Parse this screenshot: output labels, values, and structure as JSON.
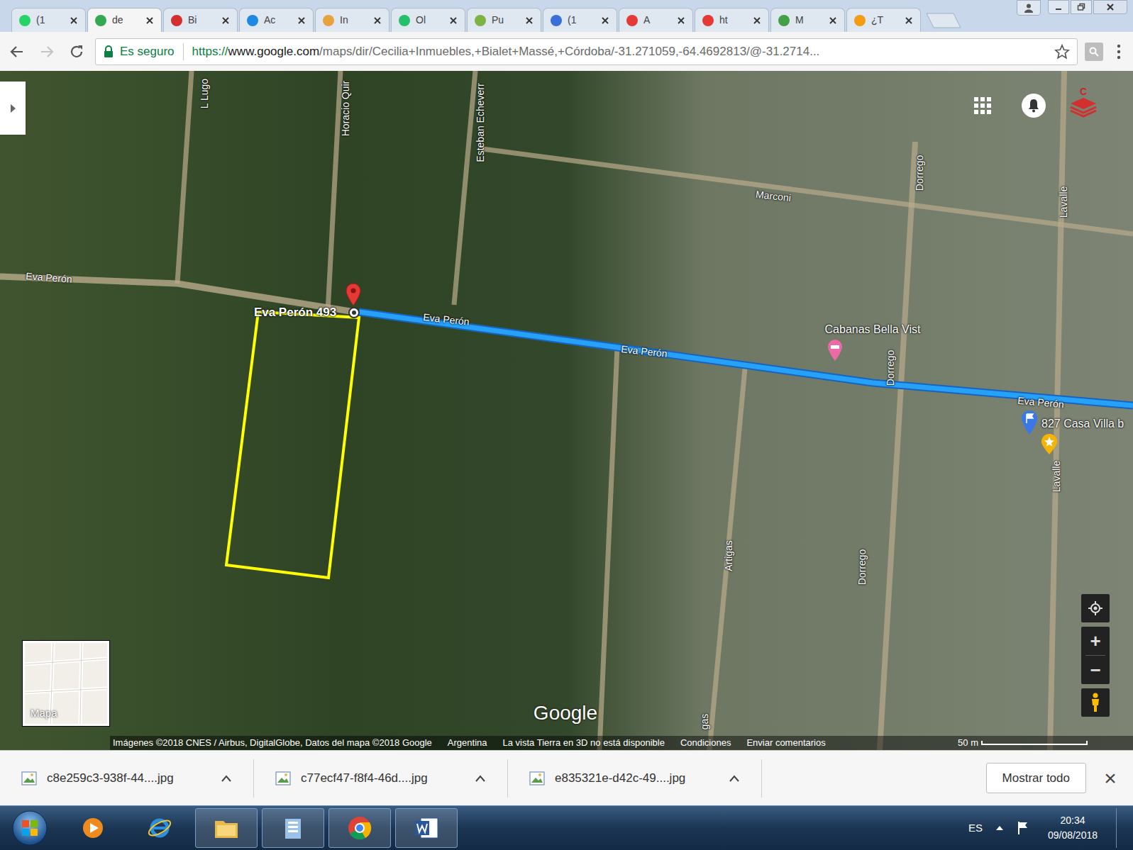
{
  "tabs": [
    {
      "label": "(1",
      "selected": false,
      "color": "#25d366"
    },
    {
      "label": "de",
      "selected": true,
      "color": "#34a853"
    },
    {
      "label": "Bi",
      "selected": false,
      "color": "#d32f2f"
    },
    {
      "label": "Ac",
      "selected": false,
      "color": "#1e88e5"
    },
    {
      "label": "In",
      "selected": false,
      "color": "#e6a23c"
    },
    {
      "label": "Ol",
      "selected": false,
      "color": "#23c16b"
    },
    {
      "label": "Pu",
      "selected": false,
      "color": "#7cb342"
    },
    {
      "label": "(1",
      "selected": false,
      "color": "#3b6fd8"
    },
    {
      "label": "A",
      "selected": false,
      "color": "#e53935"
    },
    {
      "label": "ht",
      "selected": false,
      "color": "#e53935"
    },
    {
      "label": "M",
      "selected": false,
      "color": "#43a047"
    },
    {
      "label": "¿T",
      "selected": false,
      "color": "#f39c12"
    }
  ],
  "toolbar": {
    "security": "Es seguro",
    "url_scheme": "https://",
    "url_host": "www.google.com",
    "url_path": "/maps/dir/Cecilia+Inmuebles,+Bialet+Massé,+Córdoba/-31.271059,-64.4692813/@-31.2714..."
  },
  "map": {
    "labels": [
      {
        "text": "L Lugo",
        "kind": "street"
      },
      {
        "text": "Horacio Quir",
        "kind": "street"
      },
      {
        "text": "Esteban Echeverr",
        "kind": "street"
      },
      {
        "text": "Dorrego",
        "kind": "street"
      },
      {
        "text": "Lavalle",
        "kind": "street"
      },
      {
        "text": "Marconi",
        "kind": "street"
      },
      {
        "text": "Eva Perón",
        "kind": "street"
      },
      {
        "text": "Eva Perón 493",
        "kind": "address"
      },
      {
        "text": "Eva Perón",
        "kind": "street"
      },
      {
        "text": "Eva Perón",
        "kind": "street"
      },
      {
        "text": "Cabanas Bella Vist",
        "kind": "poi"
      },
      {
        "text": "Dorrego",
        "kind": "street"
      },
      {
        "text": "Eva Perón",
        "kind": "street"
      },
      {
        "text": "827 Casa Villa b",
        "kind": "poi"
      },
      {
        "text": "Lavalle",
        "kind": "street"
      },
      {
        "text": "Artigas",
        "kind": "street"
      },
      {
        "text": "Dorrego",
        "kind": "street"
      },
      {
        "text": "gas",
        "kind": "street"
      }
    ],
    "extension_badge": "C",
    "zoom_in": "+",
    "zoom_out": "−",
    "logo": "Google",
    "thumbnail_label": "Mapa",
    "attribution": [
      "Imágenes ©2018 CNES / Airbus, DigitalGlobe, Datos del mapa ©2018 Google",
      "Argentina",
      "La vista Tierra en 3D no está disponible",
      "Condiciones",
      "Enviar comentarios"
    ],
    "scale": "50 m"
  },
  "downloads": {
    "items": [
      "c8e259c3-938f-44....jpg",
      "c77ecf47-f8f4-46d....jpg",
      "e835321e-d42c-49....jpg"
    ],
    "show_all": "Mostrar todo",
    "close": "×"
  },
  "taskbar": {
    "language": "ES",
    "time": "20:34",
    "date": "09/08/2018"
  }
}
